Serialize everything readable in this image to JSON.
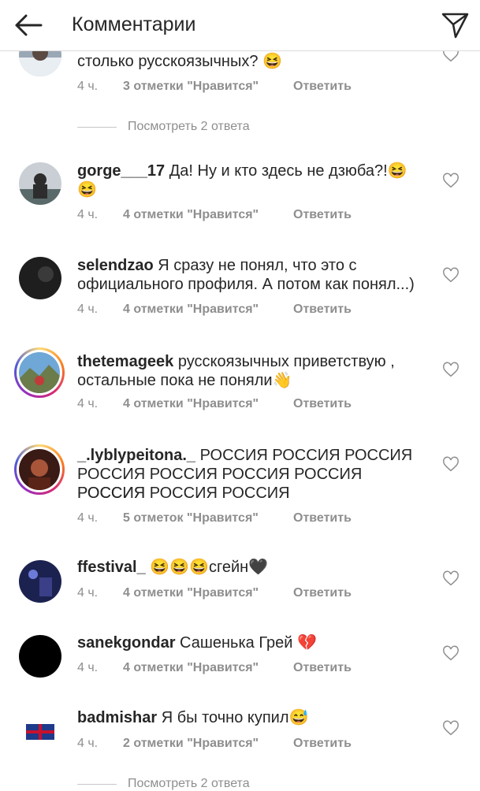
{
  "header": {
    "title": "Комментарии"
  },
  "top_comment": {
    "text_line": "столько русскоязычных? 😆",
    "time": "4 ч.",
    "likes": "3 отметки \"Нравится\"",
    "reply": "Ответить"
  },
  "view_replies_1": "Посмотреть 2 ответа",
  "comments": [
    {
      "user": "gorge___17",
      "text": "Да! Ну и кто здесь не дзюба?!😆",
      "text2": "😆",
      "time": "4 ч.",
      "likes": "4 отметки \"Нравится\"",
      "reply": "Ответить"
    },
    {
      "user": "selendzao",
      "text": "Я сразу не понял, что это с",
      "text2": "официального профиля. А потом как понял...)",
      "time": "4 ч.",
      "likes": "4 отметки \"Нравится\"",
      "reply": "Ответить"
    },
    {
      "user": "thetemageek",
      "text": "русскоязычных приветствую ,",
      "text2": "остальные пока не поняли👋",
      "time": "4 ч.",
      "likes": "4 отметки \"Нравится\"",
      "reply": "Ответить"
    },
    {
      "user": "_.lyblypeitona._",
      "text": "РОССИЯ РОССИЯ РОССИЯ",
      "text2": "РОССИЯ РОССИЯ РОССИЯ РОССИЯ РОССИЯ",
      "text3": "РОССИЯ РОССИЯ РОССИЯ",
      "time": "4 ч.",
      "likes": "5 отметок \"Нравится\"",
      "reply": "Ответить"
    },
    {
      "user": "ffestival_",
      "text": "😆😆😆сгейн🖤",
      "time": "4 ч.",
      "likes": "4 отметки \"Нравится\"",
      "reply": "Ответить"
    },
    {
      "user": "sanekgondar",
      "text": "Сашенька Грей 💔",
      "time": "4 ч.",
      "likes": "4 отметки \"Нравится\"",
      "reply": "Ответить"
    },
    {
      "user": "badmishar",
      "text": "Я бы точно купил😅",
      "time": "4 ч.",
      "likes": "2 отметки \"Нравится\"",
      "reply": "Ответить"
    }
  ],
  "view_replies_2": "Посмотреть 2 ответа",
  "icons": {
    "back": "arrow-left-icon",
    "send": "paper-plane-icon",
    "like": "heart-outline-icon"
  }
}
